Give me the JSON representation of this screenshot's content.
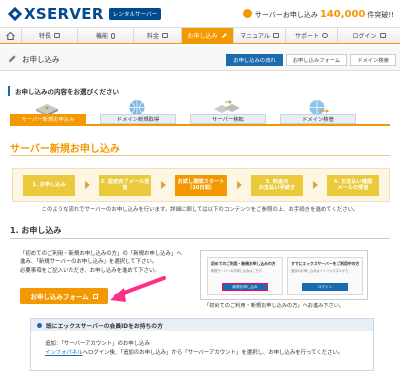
{
  "header": {
    "logo_text": "XSERVER",
    "logo_badge": "レンタルサーバー",
    "campaign_label": "サーバーお申し込み",
    "campaign_count": "140,000",
    "campaign_suffix": "件突破!!"
  },
  "nav": {
    "items": [
      {
        "label": ""
      },
      {
        "label": "特長"
      },
      {
        "label": "機能"
      },
      {
        "label": "料金"
      },
      {
        "label": "お申し込み"
      },
      {
        "label": "マニュアル"
      },
      {
        "label": "サポート"
      },
      {
        "label": "ログイン"
      }
    ],
    "active_index": 4
  },
  "title_bar": {
    "page_title": "お申し込み",
    "subtabs": [
      "お申し込みの流れ",
      "お申し込みフォーム",
      "ドメイン検索"
    ]
  },
  "content": {
    "section_heading": "お申し込みの内容をお選びください",
    "service_tabs": [
      "サーバー新規お申込み",
      "ドメイン新規取得",
      "サーバー移転",
      "ドメイン移管"
    ],
    "main_title": "サーバー新規お申し込み",
    "flow_steps": [
      {
        "line1": "1. お申し込み",
        "line2": ""
      },
      {
        "line1": "2. 設定完了メール受信",
        "line2": ""
      },
      {
        "line1": "お試し期間スタート",
        "line2": "（10日間）"
      },
      {
        "line1": "3. 料金の",
        "line2": "お支払い手続き"
      },
      {
        "line1": "4. お支払い確認",
        "line2": "メールの受信"
      }
    ],
    "flow_note": "このような流れでサーバーのお申し込みを行います。詳細に関しては以下のコンテンツをご参照の上、お手続きを進めてください。",
    "sub_heading": "1. お申し込み",
    "desc_line1": "「初めてのご利用・新規お申し込みの方」の「新規お申し込み」へ",
    "desc_line2": "進み、「新規サーバーのお申し込み」を選択して下さい。",
    "desc_line3": "必要事項をご記入いただき、お申し込みを進めて下さい。",
    "apply_button": "お申し込みフォーム",
    "preview": {
      "left_title": "初めてのご利用・新規お申し込みの方",
      "left_text": "新規サーバーのお申し込みはこちら",
      "left_button": "新規お申し込み",
      "right_title": "すでにエックスサーバーをご利用中の方",
      "right_text": "追加のお申し込みはインフォパネルから",
      "right_button": "ログイン"
    },
    "preview_caption": "「初めてのご利用・新規お申し込みの方」へお進み下さい。",
    "box2_heading": "既にエックスサーバーの会員IDをお持ちの方",
    "box2_line1": "追加：「サーバーアカウント」のお申し込み",
    "box2_link": "インフォパネル",
    "box2_line2_rest": "へログイン後、「追加のお申し込み」から「サーバーアカウント」を選択し、お申し込みを行ってください。"
  }
}
